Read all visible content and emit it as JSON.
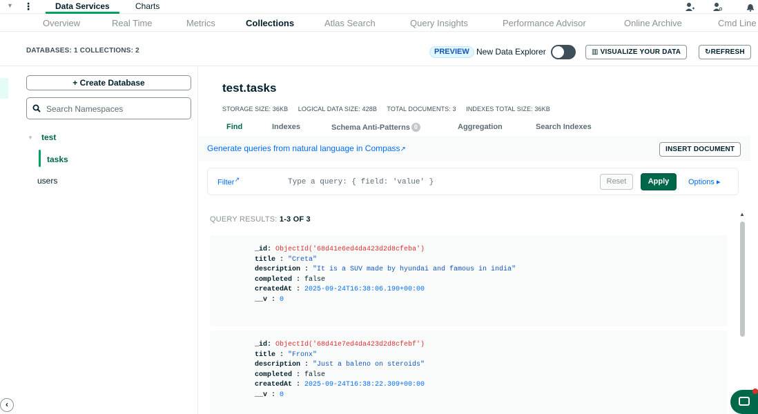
{
  "topbar": {
    "tabs": [
      {
        "label": "Data Services",
        "active": true
      },
      {
        "label": "Charts",
        "active": false
      }
    ],
    "icons": [
      "user-add-icon",
      "user-settings-icon",
      "bell-icon"
    ]
  },
  "subnav": {
    "tabs": [
      {
        "label": "Overview",
        "active": false
      },
      {
        "label": "Real Time",
        "active": false
      },
      {
        "label": "Metrics",
        "active": false
      },
      {
        "label": "Collections",
        "active": true
      },
      {
        "label": "Atlas Search",
        "active": false
      },
      {
        "label": "Query Insights",
        "active": false
      },
      {
        "label": "Performance Advisor",
        "active": false
      },
      {
        "label": "Online Archive",
        "active": false
      },
      {
        "label": "Cmd Line",
        "active": false
      }
    ]
  },
  "infobar": {
    "counts": "DATABASES: 1  COLLECTIONS: 2",
    "preview_badge": "PREVIEW",
    "explorer_label": "New Data Explorer",
    "explorer_toggle_on": false,
    "visualize_label": "VISUALIZE YOUR DATA",
    "refresh_label": "REFRESH"
  },
  "sidebar": {
    "create_db_label": "+ Create Database",
    "search_placeholder": "Search Namespaces",
    "database": "test",
    "collections": [
      {
        "label": "tasks",
        "active": true
      },
      {
        "label": "users",
        "active": false
      }
    ]
  },
  "main": {
    "title": "test.tasks",
    "stats": [
      "STORAGE SIZE: 36KB",
      "LOGICAL DATA SIZE: 428B",
      "TOTAL DOCUMENTS: 3",
      "INDEXES TOTAL SIZE: 36KB"
    ],
    "tabs": [
      {
        "label": "Find",
        "active": true
      },
      {
        "label": "Indexes",
        "active": false
      },
      {
        "label": "Schema Anti-Patterns",
        "active": false,
        "count": "0"
      },
      {
        "label": "Aggregation",
        "active": false
      },
      {
        "label": "Search Indexes",
        "active": false
      }
    ],
    "generate_link": "Generate queries from natural language in Compass",
    "insert_label": "INSERT DOCUMENT",
    "filter_label": "Filter",
    "filter_placeholder": "Type a query: { field: 'value' }",
    "reset_label": "Reset",
    "apply_label": "Apply",
    "options_label": "Options ▸",
    "results_prefix": "QUERY RESULTS: ",
    "results_range": "1-3 OF 3",
    "documents": [
      {
        "_id": "ObjectId('68d41e6ed4da423d2d8cfeba')",
        "title": "\"Creta\"",
        "description": "\"It is a SUV made by hyundai and famous in india\"",
        "completed": "false",
        "createdAt": "2025-09-24T16:38:06.190+00:00",
        "__v": "0"
      },
      {
        "_id": "ObjectId('68d41e7ed4da423d2d8cfebf')",
        "title": "\"Fronx\"",
        "description": "\"Just a baleno on steroids\"",
        "completed": "false",
        "createdAt": "2025-09-24T16:38:22.309+00:00",
        "__v": "0"
      }
    ]
  },
  "colors": {
    "brand_green": "#00684a",
    "accent_green": "#00a35c",
    "link_blue": "#016bf8",
    "objectid_red": "#db3030"
  }
}
